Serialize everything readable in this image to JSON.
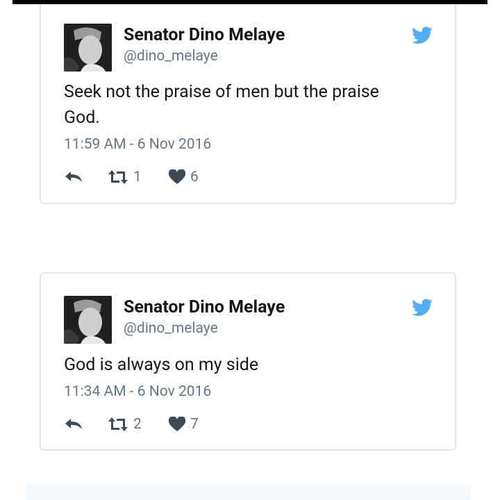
{
  "colors": {
    "text_primary": "#14171a",
    "text_secondary": "#657786",
    "twitter_blue": "#55acee",
    "card_border": "#e1e8ed"
  },
  "tweets": [
    {
      "author_name": "Senator Dino Melaye",
      "author_handle": "@dino_melaye",
      "text": "Seek not the praise of men but the praise God.",
      "timestamp": "11:59 AM - 6 Nov 2016",
      "retweets": "1",
      "likes": "6",
      "icons": [
        "avatar",
        "twitter-bird-icon",
        "reply-icon",
        "retweet-icon",
        "heart-icon"
      ]
    },
    {
      "author_name": "Senator Dino Melaye",
      "author_handle": "@dino_melaye",
      "text": "God is always on my side",
      "timestamp": "11:34 AM - 6 Nov 2016",
      "retweets": "2",
      "likes": "7",
      "icons": [
        "avatar",
        "twitter-bird-icon",
        "reply-icon",
        "retweet-icon",
        "heart-icon"
      ]
    }
  ]
}
